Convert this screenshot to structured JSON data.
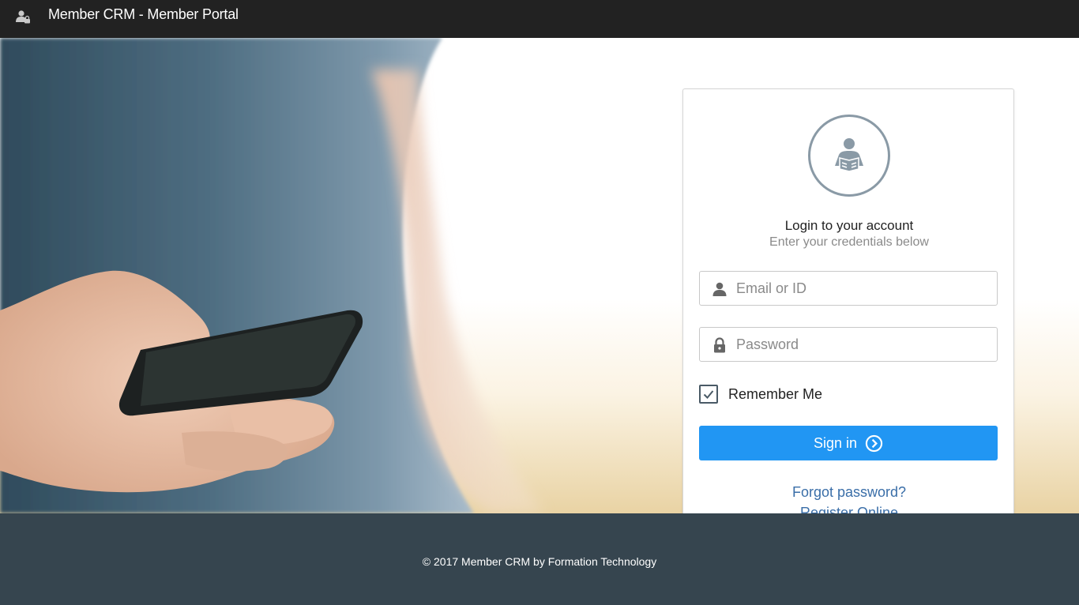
{
  "header": {
    "title": "Member CRM - Member Portal",
    "icon": "user-lock-icon"
  },
  "login": {
    "avatar_icon": "reader-icon",
    "title": "Login to your account",
    "subtitle": "Enter your credentials below",
    "email_field": {
      "placeholder": "Email or ID",
      "value": "",
      "icon": "user-icon"
    },
    "password_field": {
      "placeholder": "Password",
      "value": "",
      "icon": "lock-icon"
    },
    "remember_me": {
      "label": "Remember Me",
      "checked": true
    },
    "sign_in_label": "Sign in",
    "sign_in_icon": "chevron-circle-right-icon",
    "forgot_password": "Forgot password?",
    "register": "Register Online"
  },
  "footer": {
    "copyright": "© 2017 Member CRM by Formation Technology"
  },
  "colors": {
    "topbar": "#222222",
    "primary_button": "#2196f3",
    "link": "#3a6ea8",
    "footer": "#36454f"
  }
}
